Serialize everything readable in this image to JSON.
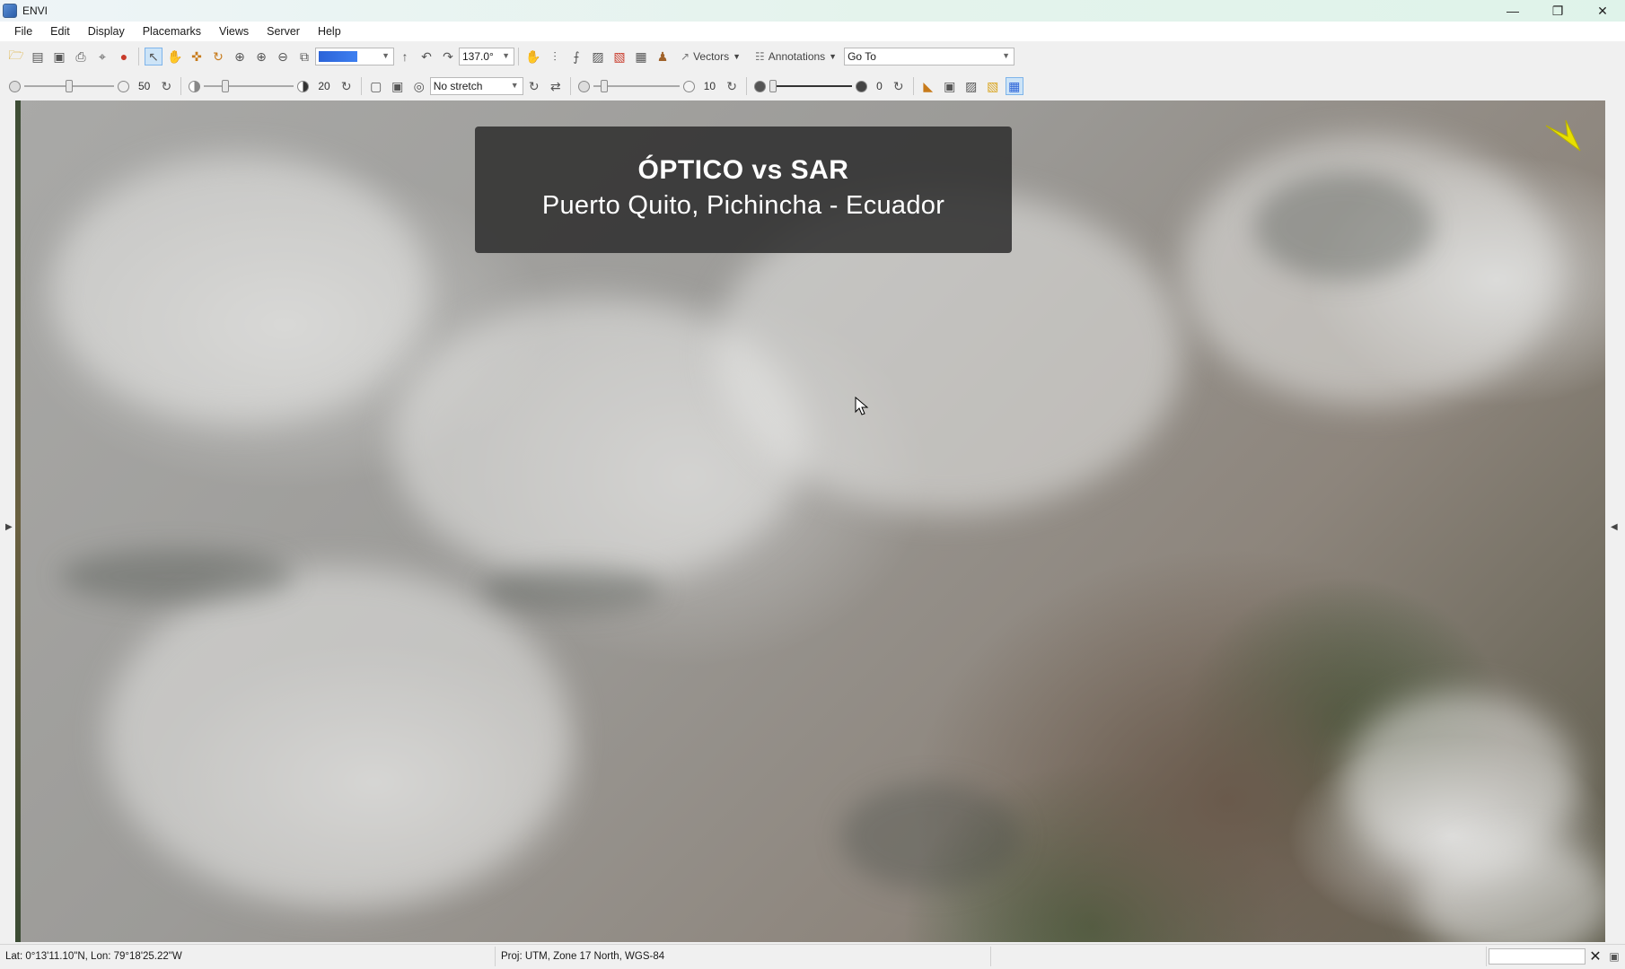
{
  "window": {
    "title": "ENVI"
  },
  "menu": [
    "File",
    "Edit",
    "Display",
    "Placemarks",
    "Views",
    "Server",
    "Help"
  ],
  "toolbar1": {
    "rotation_value": "137.0°",
    "vectors_label": "Vectors",
    "annotations_label": "Annotations",
    "goto_placeholder": "Go To"
  },
  "toolbar2": {
    "brightness_value": "50",
    "contrast_value": "20",
    "stretch_value": "No stretch",
    "sharpen_value": "10",
    "transparency_value": "0"
  },
  "banner": {
    "title": "ÓPTICO vs SAR",
    "subtitle": "Puerto Quito, Pichincha - Ecuador"
  },
  "status": {
    "latlon": "Lat: 0°13'11.10\"N, Lon: 79°18'25.22\"W",
    "projection": "Proj: UTM, Zone 17 North, WGS-84"
  },
  "colors": {
    "accent": "#2b63d8",
    "north_arrow": "#e8e000",
    "banner_bg": "#2d2d2d"
  }
}
